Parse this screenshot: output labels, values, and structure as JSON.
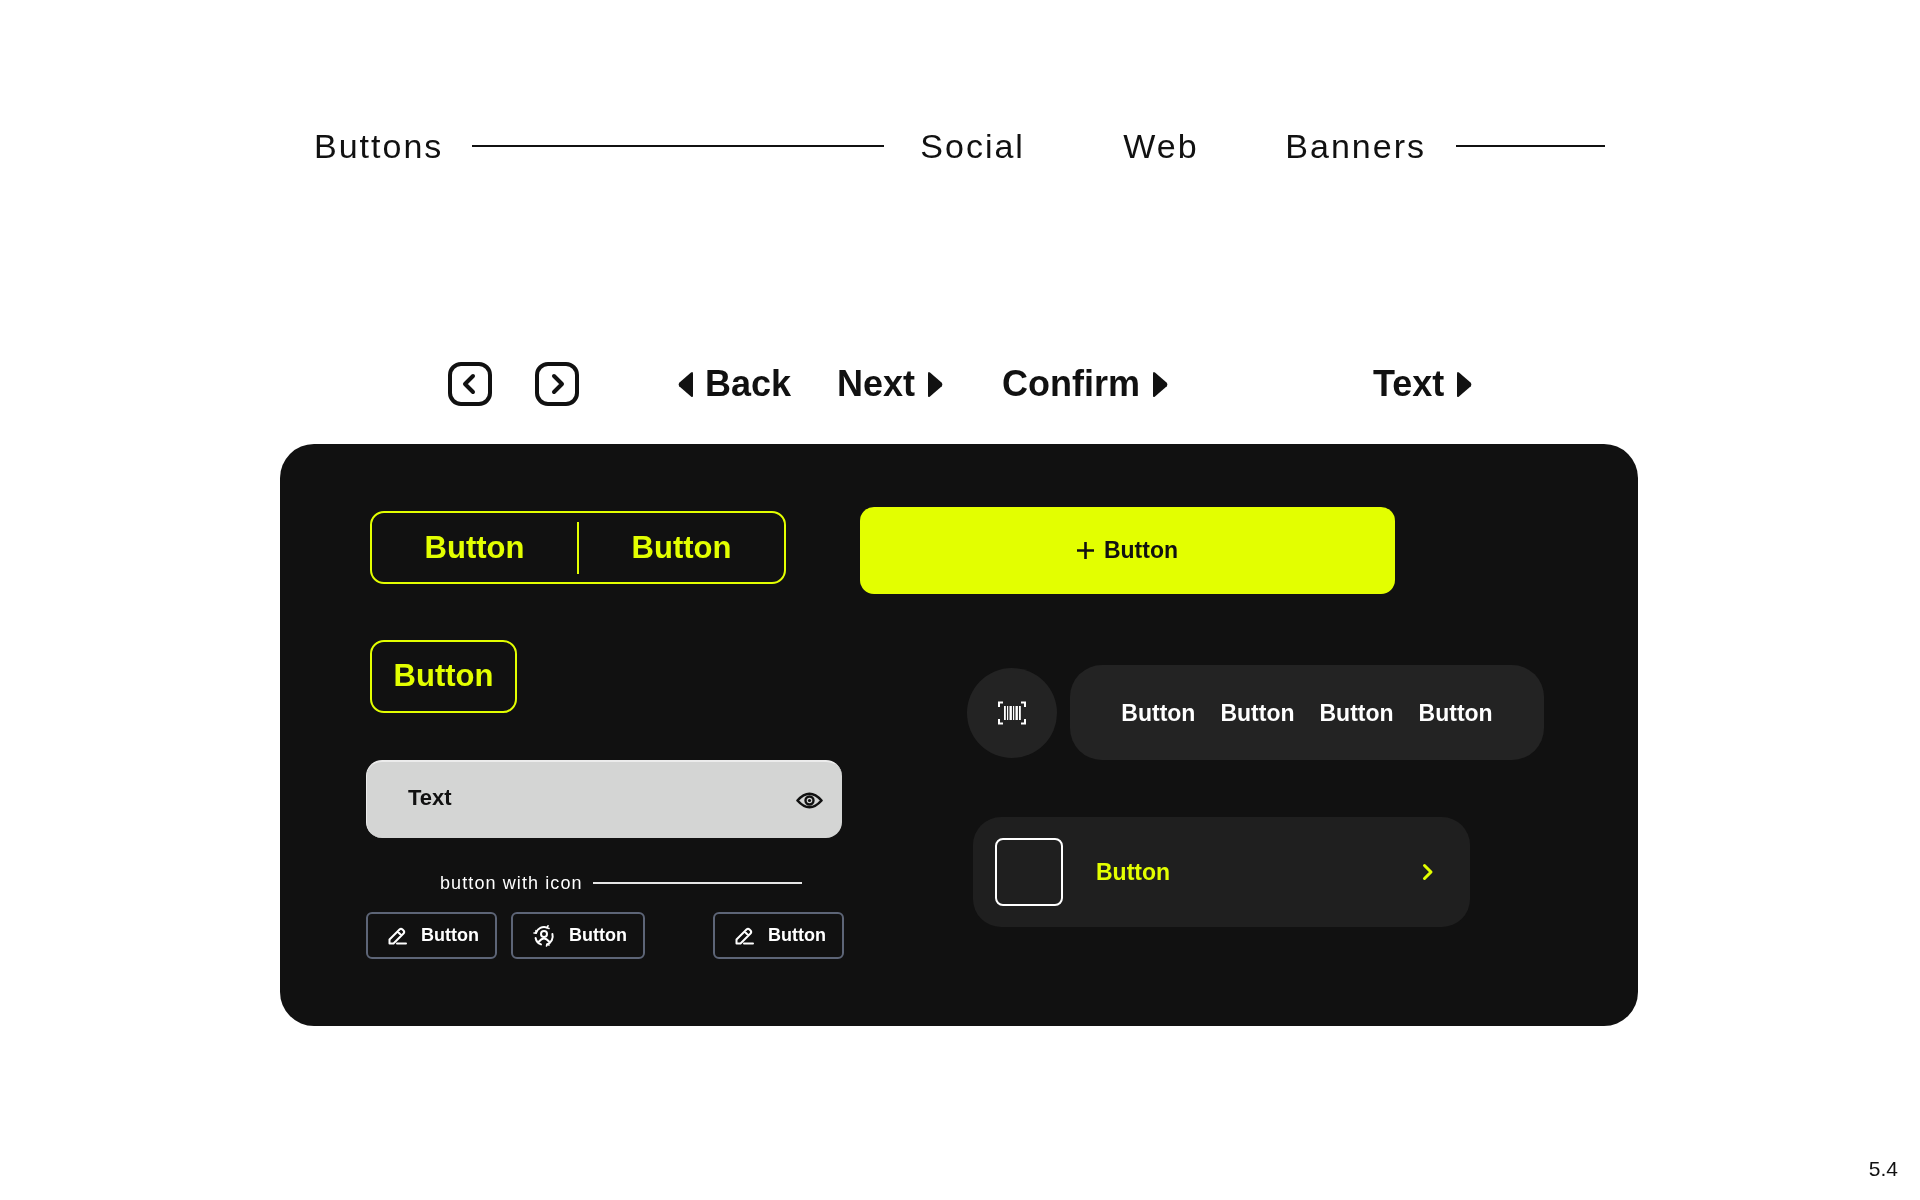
{
  "nav": {
    "items": [
      {
        "label": "Buttons",
        "divider": true
      },
      {
        "label": "Social",
        "divider": false
      },
      {
        "label": "Web",
        "divider": false
      },
      {
        "label": "Banners",
        "divider": true
      }
    ]
  },
  "arrow_row": {
    "items": [
      {
        "label": "Back",
        "kind": "back"
      },
      {
        "label": "Next",
        "kind": "forward"
      },
      {
        "label": "Confirm",
        "kind": "forward"
      },
      {
        "label": "Text",
        "kind": "forward"
      }
    ]
  },
  "panel": {
    "split_button": [
      "Button",
      "Button"
    ],
    "outline_button": {
      "label": "Button"
    },
    "text_field": {
      "value": "Text"
    },
    "icon_buttons_caption": "button with icon",
    "icon_buttons": [
      {
        "label": "Button",
        "kind": "edit"
      },
      {
        "label": "Button",
        "kind": "user"
      },
      {
        "label": "Button",
        "kind": "edit"
      }
    ],
    "primary_button": {
      "label": "Button"
    },
    "segmented_bar": [
      "Button",
      "Button",
      "Button",
      "Button"
    ],
    "list_item": {
      "label": "Button"
    }
  },
  "page_number": "5.4"
}
